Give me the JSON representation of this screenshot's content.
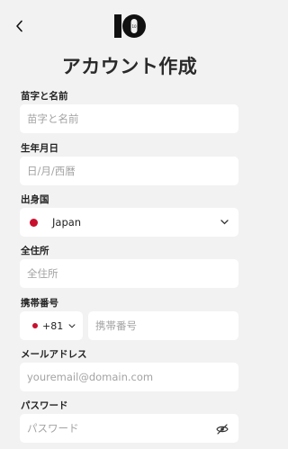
{
  "header": {
    "logo_text": "10"
  },
  "title": "アカウント作成",
  "fields": {
    "name": {
      "label": "苗字と名前",
      "placeholder": "苗字と名前"
    },
    "birthdate": {
      "label": "生年月日",
      "placeholder": "日/月/西暦"
    },
    "country": {
      "label": "出身国",
      "value": "Japan"
    },
    "address": {
      "label": "全住所",
      "placeholder": "全住所"
    },
    "phone": {
      "label": "携帯番号",
      "code": "+81",
      "placeholder": "携帯番号"
    },
    "email": {
      "label": "メールアドレス",
      "placeholder": "youremail@domain.com"
    },
    "password": {
      "label": "パスワード",
      "placeholder": "パスワード"
    }
  },
  "icons": {
    "back": "chevron-left-icon",
    "country_dropdown": "chevron-down-icon",
    "phone_dropdown": "chevron-down-icon",
    "password_toggle": "eye-slash-icon"
  },
  "colors": {
    "background": "#f2f2f2",
    "field": "#ffffff",
    "flag_red": "#c8102e"
  }
}
